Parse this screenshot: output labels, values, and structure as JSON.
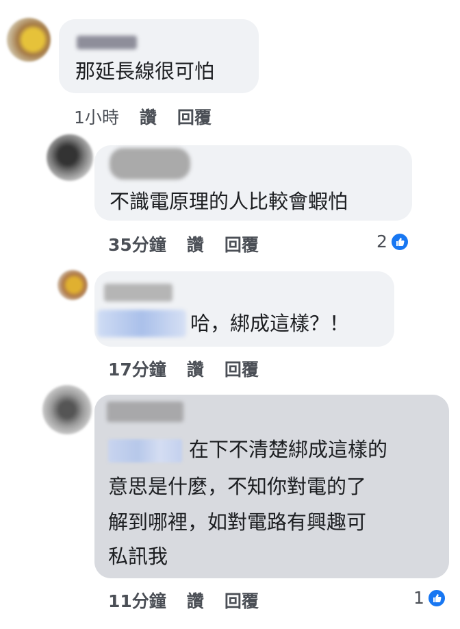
{
  "comments": [
    {
      "text_lines": [
        "那延長線很可怕"
      ],
      "time": "1小時",
      "like_label": "讚",
      "reply_label": "回覆"
    },
    {
      "text_lines": [
        "不識電原理的人比較會蝦怕"
      ],
      "time": "35分鐘",
      "like_label": "讚",
      "reply_label": "回覆",
      "reaction_count": "2"
    },
    {
      "text_lines": [
        "哈，綁成這樣？！"
      ],
      "time": "17分鐘",
      "like_label": "讚",
      "reply_label": "回覆"
    },
    {
      "text_lines": [
        "在下不清楚綁成這樣的",
        "意思是什麼，不知你對電的了",
        "解到哪裡，如對電路有興趣可",
        "私訊我"
      ],
      "time": "11分鐘",
      "like_label": "讚",
      "reply_label": "回覆",
      "reaction_count": "1"
    }
  ],
  "icons": {
    "reaction": "like-icon"
  },
  "colors": {
    "bubble": "#f0f2f5",
    "highlight_bubble": "#d8dadf",
    "like_blue": "#1877f2"
  }
}
